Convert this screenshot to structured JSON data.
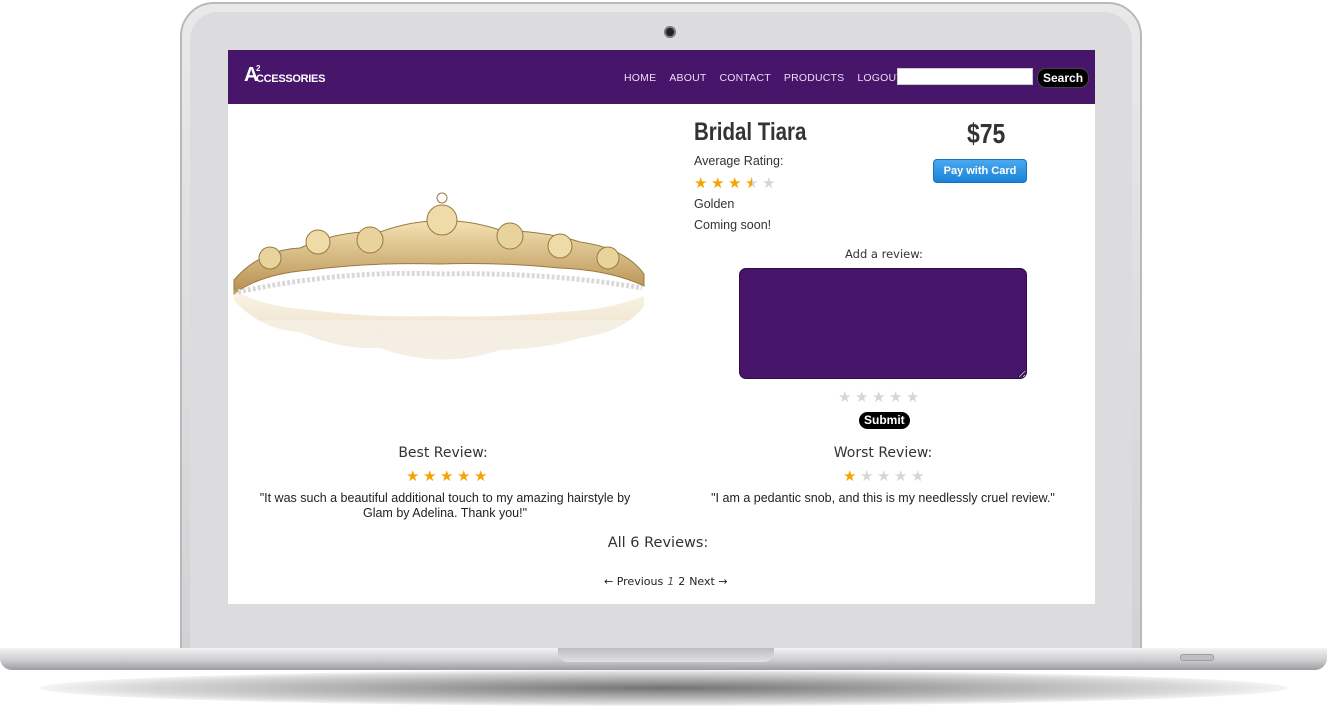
{
  "navbar": {
    "logo_big": "A",
    "logo_sup": "2",
    "logo_rest": "CCESSORIES",
    "links": [
      "HOME",
      "ABOUT",
      "CONTACT",
      "PRODUCTS",
      "LOGOUT"
    ],
    "search_value": "",
    "search_button": "Search"
  },
  "product": {
    "name": "Bridal Tiara",
    "price": "$75",
    "pay_button": "Pay with Card",
    "average_label": "Average Rating:",
    "average_rating": 3.5,
    "color": "Golden",
    "status": "Coming soon!"
  },
  "review_form": {
    "label": "Add a review:",
    "text_value": "",
    "rating": 0,
    "submit": "Submit"
  },
  "best_review": {
    "title": "Best Review:",
    "rating": 5,
    "text": "\"It was such a beautiful additional touch to my amazing hairstyle by Glam by Adelina. Thank you!\""
  },
  "worst_review": {
    "title": "Worst Review:",
    "rating": 1,
    "text": "\"I am a pedantic snob, and this is my needlessly cruel review.\""
  },
  "all_reviews_title": "All 6 Reviews:",
  "pagination": {
    "previous": "← Previous",
    "pages": [
      "1",
      "2"
    ],
    "current": "1",
    "next": "Next →"
  },
  "colors": {
    "brand_purple": "#47166b",
    "star_filled": "#f5a300",
    "star_empty": "#d6d6d6",
    "pay_button_blue": "#2b95e4"
  }
}
